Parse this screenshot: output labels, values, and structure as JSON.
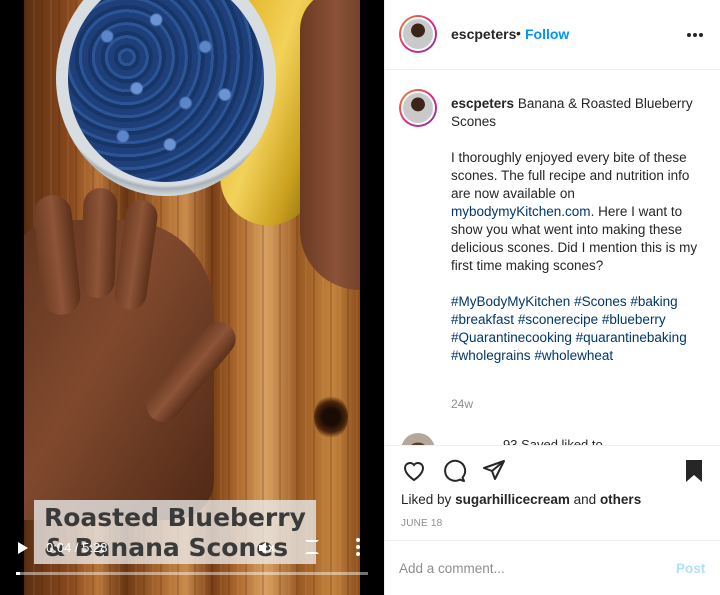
{
  "video": {
    "overlay_caption": "Roasted Blueberry & Banana Scones",
    "current_time": "0:04",
    "duration": "5:28",
    "time_separator": " / ",
    "progress_fraction": 0.012
  },
  "header": {
    "username": "escpeters",
    "separator": "•",
    "follow_label": "Follow"
  },
  "post_caption": {
    "username": "escpeters",
    "title": "Banana & Roasted Blueberry Scones",
    "body_before_link": "I thoroughly enjoyed every bite of these scones. The full recipe and nutrition info are now available on ",
    "link_text": "mybodymyKitchen.com",
    "body_after_link": ". Here I want to show you what went into making these delicious scones. Did I mention this is my first time making scones?",
    "hashtags": [
      "#MyBodyMyKitchen",
      "#Scones",
      "#baking",
      "#breakfast",
      "#sconerecipe",
      "#blueberry",
      "#Quarantinecooking",
      "#quarantinebaking",
      "#wholegrains",
      "#wholewheat"
    ],
    "age": "24w"
  },
  "next_comment": {
    "partial_text": "93 Saved liked to"
  },
  "actions": {
    "liked_by_prefix": "Liked by",
    "liked_by_user": "sugarhillicecream",
    "liked_by_and": "and",
    "liked_by_others": "others",
    "date": "JUNE 18"
  },
  "comment_box": {
    "placeholder": "Add a comment...",
    "post_label": "Post"
  },
  "colors": {
    "follow_blue": "#0095f6",
    "link_blue": "#00376b",
    "post_disabled": "#b2dffc",
    "muted_gray": "#8e8e8e"
  },
  "icons": [
    "play-icon",
    "mute-icon",
    "fullscreen-icon",
    "more-vertical-icon",
    "more-horizontal-icon",
    "heart-icon",
    "comment-icon",
    "share-icon",
    "bookmark-icon"
  ]
}
